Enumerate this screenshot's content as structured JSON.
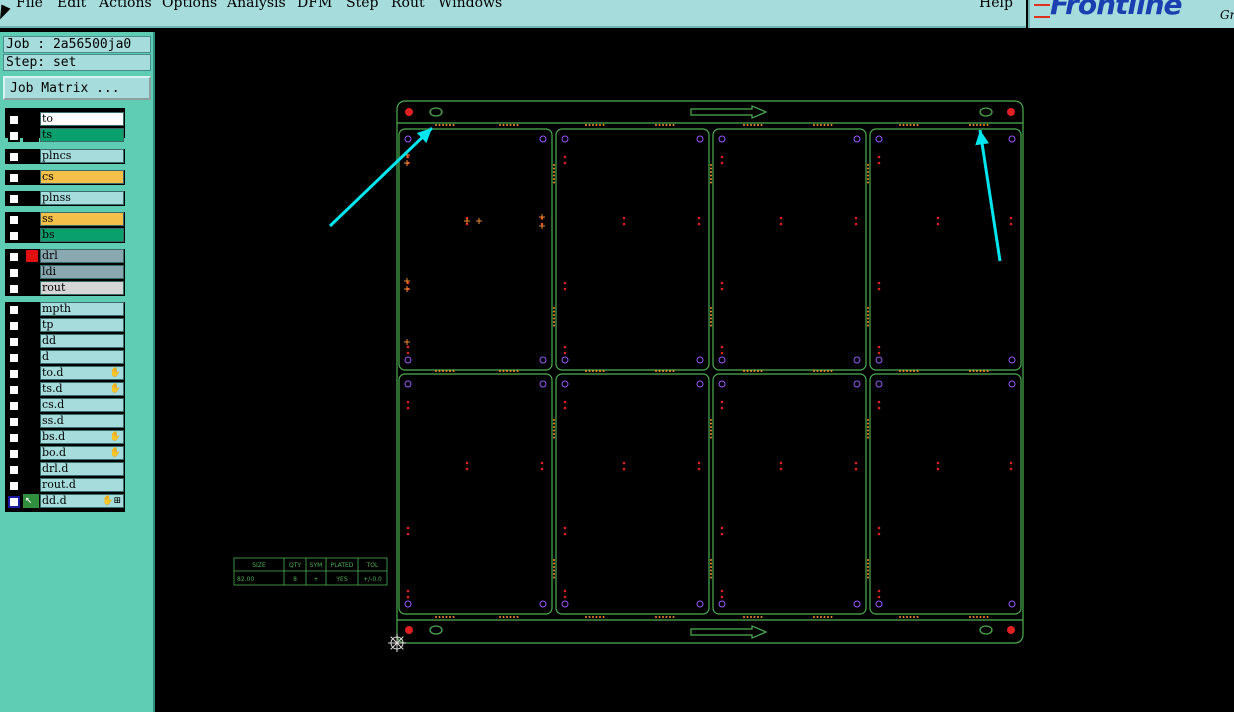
{
  "menubar": {
    "items": [
      "File",
      "Edit",
      "Actions",
      "Options",
      "Analysis",
      "DFM",
      "Step",
      "Rout",
      "Windows"
    ],
    "help": "Help"
  },
  "logo": {
    "text": "Frontline",
    "suffix": "Gr"
  },
  "job_panel": {
    "job": "Job : 2a56500ja0",
    "step": "Step: set",
    "matrix_button": "Job Matrix ..."
  },
  "layers": [
    {
      "name": "to",
      "color": "#ffffff"
    },
    {
      "name": "ts",
      "color": "#0aa06e"
    },
    {
      "name": "plncs",
      "color": "#a6dcdc"
    },
    {
      "name": "cs",
      "color": "#f5c04a"
    },
    {
      "name": "plnss",
      "color": "#a6dcdc"
    },
    {
      "name": "ss",
      "color": "#f5c04a"
    },
    {
      "name": "bs",
      "color": "#0aa06e"
    },
    {
      "name": "drl",
      "color": "#8aa8b0"
    },
    {
      "name": "ldi",
      "color": "#8aa8b0"
    },
    {
      "name": "rout",
      "color": "#d6d6d6"
    },
    {
      "name": "mpth",
      "color": "#a6dcdc"
    },
    {
      "name": "tp",
      "color": "#a6dcdc"
    },
    {
      "name": "dd",
      "color": "#a6dcdc"
    },
    {
      "name": "d",
      "color": "#a6dcdc"
    },
    {
      "name": "to.d",
      "color": "#a6dcdc"
    },
    {
      "name": "ts.d",
      "color": "#a6dcdc"
    },
    {
      "name": "cs.d",
      "color": "#a6dcdc"
    },
    {
      "name": "ss.d",
      "color": "#a6dcdc"
    },
    {
      "name": "bs.d",
      "color": "#a6dcdc"
    },
    {
      "name": "bo.d",
      "color": "#a6dcdc"
    },
    {
      "name": "drl.d",
      "color": "#a6dcdc"
    },
    {
      "name": "rout.d",
      "color": "#a6dcdc"
    },
    {
      "name": "dd.d",
      "color": "#a6dcdc"
    }
  ],
  "drill_table": {
    "headers": [
      "SIZE",
      "QTY",
      "SYM",
      "PLATED",
      "TOL"
    ],
    "row": [
      "82.00",
      "8",
      "+",
      "YES",
      "+/-0.0"
    ]
  },
  "colors": {
    "outline": "#4caf50",
    "drill_hole": "#e02020",
    "via_circle": "#9b59ff",
    "orange_mark": "#f08a30",
    "arrow_annotation": "#00e5ee"
  }
}
